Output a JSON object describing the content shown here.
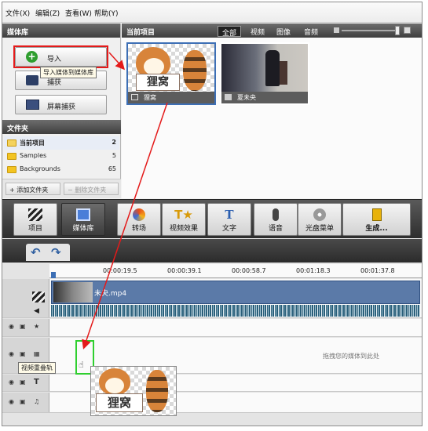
{
  "menu": [
    "文件(X)",
    "编辑(Z)",
    "查看(W)",
    "帮助(Y)"
  ],
  "left_panel": {
    "title": "媒体库",
    "import_label": "导入",
    "import_tooltip": "导入媒体到媒体库",
    "capture_label": "捕获",
    "screen_capture_label": "屏幕捕获",
    "folders_title": "文件夹",
    "folders": [
      {
        "name": "当前项目",
        "count": "2"
      },
      {
        "name": "Samples",
        "count": "5"
      },
      {
        "name": "Backgrounds",
        "count": "65"
      }
    ],
    "add_folder_label": "添加文件夹",
    "delete_folder_label": "删除文件夹"
  },
  "media": {
    "title": "当前项目",
    "filters": [
      "全部",
      "视频",
      "图像",
      "音频"
    ],
    "items": [
      {
        "caption": "狸窝",
        "thumb_text": "狸窝"
      },
      {
        "caption": "夏未央"
      }
    ]
  },
  "toolbar": [
    {
      "label": "项目",
      "icon": "clapperboard-icon"
    },
    {
      "label": "媒体库",
      "icon": "film-library-icon"
    },
    {
      "label": "转场",
      "icon": "transition-icon"
    },
    {
      "label": "视频效果",
      "icon": "video-effects-icon"
    },
    {
      "label": "文字",
      "icon": "text-icon"
    },
    {
      "label": "语音",
      "icon": "microphone-icon"
    },
    {
      "label": "光盘菜单",
      "icon": "disc-menu-icon"
    },
    {
      "label": "生成...",
      "icon": "produce-icon"
    }
  ],
  "timeline": {
    "ticks": [
      "00:00:19.5",
      "00:00:39.1",
      "00:00:58.7",
      "00:01:18.3",
      "00:01:37.8"
    ],
    "clip_name": "未央.mp4",
    "drop_hint": "拖拽您的媒体到此处",
    "overlay_tooltip": "视频重叠轨",
    "drag_thumb_text": "狸窝"
  },
  "colors": {
    "accent_red": "#e41a1a",
    "selection_blue": "#3d6fb5",
    "drop_target_green": "#2fcf2f",
    "audio_wave": "#2a5f7a"
  }
}
